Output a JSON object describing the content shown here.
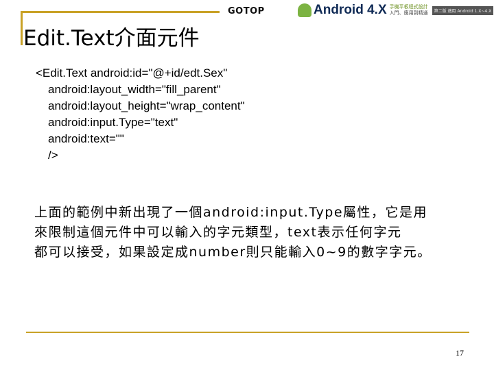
{
  "header": {
    "publisher_logo": "GOTOP",
    "book_title": "Android 4.X",
    "book_subtitle_line1": "手機平板程式設計",
    "book_subtitle_line2": "入門、應用到精通",
    "edition_tag": "第二版 適用 Android 1.X~4.X"
  },
  "slide": {
    "title": "Edit.Text介面元件",
    "code_lines": [
      "<Edit.Text android:id=\"@+id/edt.Sex\"",
      "android:layout_width=\"fill_parent\"",
      "android:layout_height=\"wrap_content\"",
      "android:input.Type=\"text\"",
      "android:text=\"\"",
      "/>"
    ],
    "description_lines": [
      "上面的範例中新出現了一個android:input.Type屬性，它是用",
      "來限制這個元件中可以輸入的字元類型，text表示任何字元",
      "都可以接受，如果設定成number則只能輸入0~9的數字字元。"
    ],
    "page_number": "17"
  },
  "colors": {
    "accent_gold": "#c9a227",
    "gotop_orange": "#e07a00",
    "android_green": "#7cb342",
    "book_title_navy": "#0f2a55"
  }
}
